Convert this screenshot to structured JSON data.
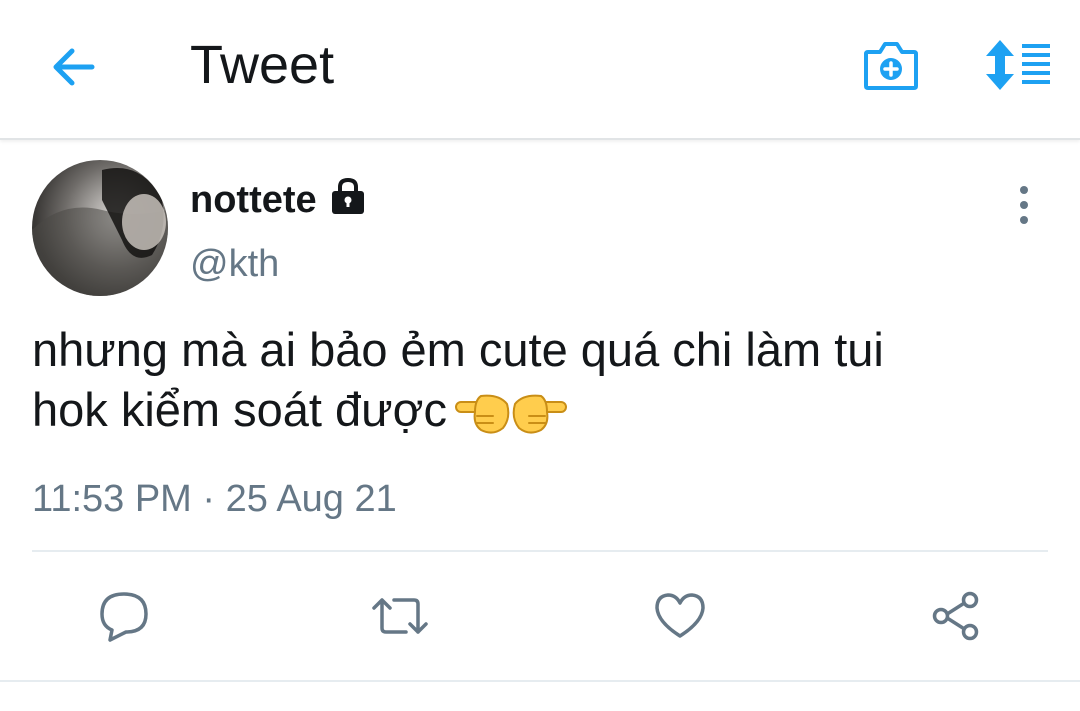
{
  "header": {
    "title": "Tweet",
    "back_icon": "arrow-left-icon",
    "camera_icon": "camera-add-icon",
    "sort_icon": "sort-list-icon",
    "accent_color": "#1da1f2"
  },
  "tweet": {
    "display_name": "nottete",
    "protected_icon": "lock-icon",
    "handle": "@kth",
    "text_line1": "nhưng mà ai bảo ẻm cute quá chi làm tui",
    "text_line2": "hok kiểm soát được",
    "emojis": [
      "pointing-left-emoji",
      "pointing-right-emoji"
    ],
    "timestamp": "11:53 PM · 25 Aug 21"
  },
  "actions": [
    {
      "name": "reply",
      "icon": "reply-icon"
    },
    {
      "name": "retweet",
      "icon": "retweet-icon"
    },
    {
      "name": "like",
      "icon": "heart-icon"
    },
    {
      "name": "share",
      "icon": "share-icon"
    }
  ]
}
